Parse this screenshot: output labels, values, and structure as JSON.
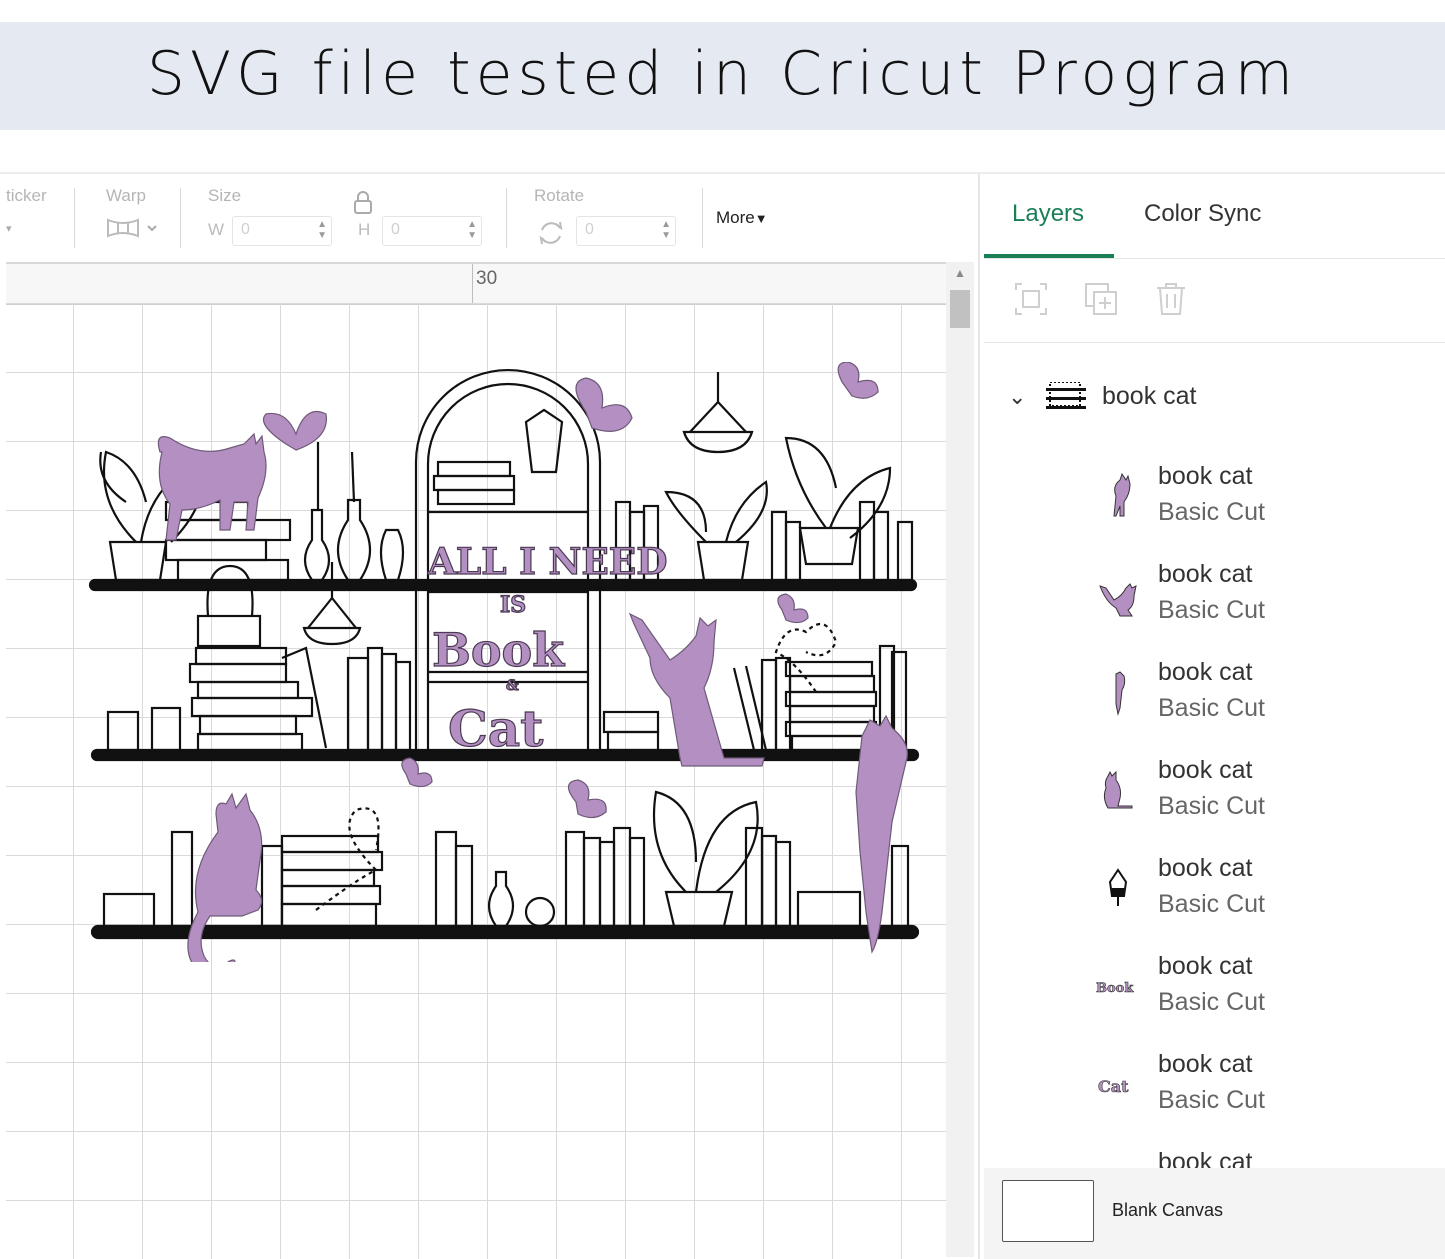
{
  "banner": {
    "title": "SVG file tested in Cricut Program"
  },
  "toolbar": {
    "sticker_label": "ticker",
    "warp_label": "Warp",
    "size_label": "Size",
    "w_label": "W",
    "w_value": "0",
    "h_label": "H",
    "h_value": "0",
    "rotate_label": "Rotate",
    "rotate_value": "0",
    "more_label": "More"
  },
  "canvas": {
    "ruler_label": "30"
  },
  "panel": {
    "tabs": [
      {
        "label": "Layers",
        "active": true
      },
      {
        "label": "Color Sync",
        "active": false
      }
    ],
    "group": {
      "name": "book cat"
    },
    "layers": [
      {
        "name": "book cat",
        "type": "Basic Cut",
        "icon": "cat-standing-icon"
      },
      {
        "name": "book cat",
        "type": "Basic Cut",
        "icon": "cat-climbing-icon"
      },
      {
        "name": "book cat",
        "type": "Basic Cut",
        "icon": "cat-hanging-icon"
      },
      {
        "name": "book cat",
        "type": "Basic Cut",
        "icon": "cat-sitting-icon"
      },
      {
        "name": "book cat",
        "type": "Basic Cut",
        "icon": "terrarium-icon"
      },
      {
        "name": "book cat",
        "type": "Basic Cut",
        "icon": "book-word-icon"
      },
      {
        "name": "book cat",
        "type": "Basic Cut",
        "icon": "cat-word-icon"
      },
      {
        "name": "book cat",
        "type": "",
        "icon": "cat-icon"
      }
    ],
    "blank_canvas_label": "Blank Canvas"
  },
  "colors": {
    "accent": "#1a7f55",
    "cut_purple": "#b48fc2",
    "banner_bg": "#e5e9f1"
  }
}
